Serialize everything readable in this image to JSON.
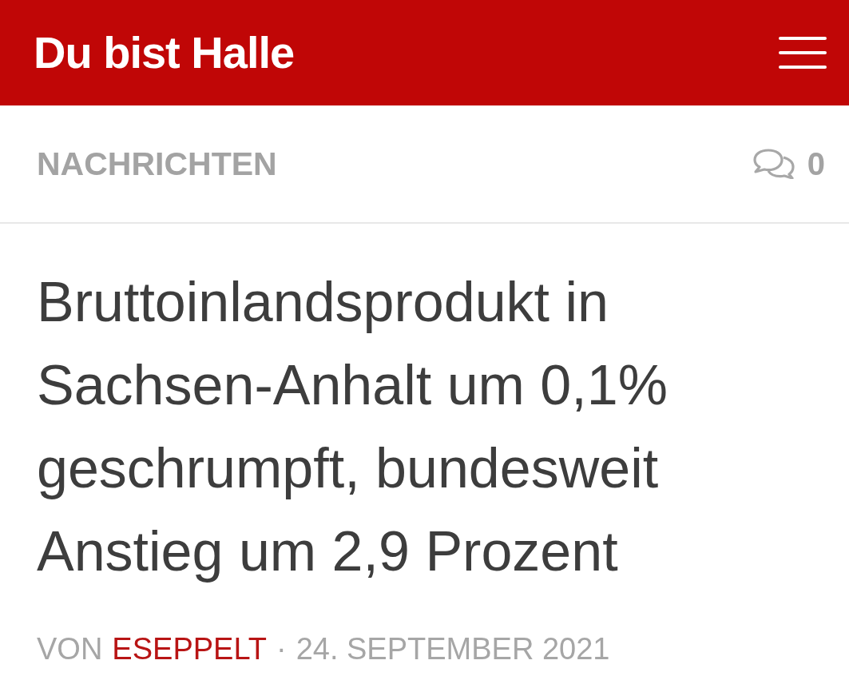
{
  "header": {
    "site_title": "Du bist Halle"
  },
  "category_bar": {
    "category": "NACHRICHTEN",
    "comment_count": "0"
  },
  "article": {
    "headline": "Bruttoinlandsprodukt in Sachsen-Anhalt um 0,1% geschrumpft, bundesweit Anstieg um 2,9 Prozent",
    "byline": {
      "prefix": "VON",
      "author": "ESEPPELT",
      "separator": "·",
      "date": "24. SEPTEMBER 2021"
    }
  }
}
